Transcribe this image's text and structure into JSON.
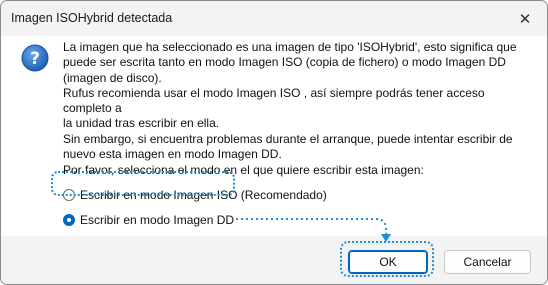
{
  "window": {
    "title": "Imagen ISOHybrid detectada",
    "close_icon": "close-icon"
  },
  "message": {
    "icon": "question-icon",
    "paragraph1": "La imagen que ha seleccionado es una imagen de tipo 'ISOHybrid', esto significa que\npuede ser escrita tanto en modo Imagen ISO (copia de fichero) o modo Imagen DD\n(imagen de disco).",
    "paragraph2": "Rufus recomienda usar el modo Imagen ISO , así siempre podrás tener acceso completo a\nla unidad tras escribir en ella.",
    "paragraph3": "Sin embargo, si encuentra problemas durante el arranque, puede intentar escribir de\nnuevo esta imagen en modo Imagen DD.",
    "prompt": "Por favor, selecciona el modo en el que quiere escribir esta imagen:"
  },
  "options": {
    "iso_label": "Escribir en modo Imagen ISO (Recomendado)",
    "dd_label": "Escribir en modo Imagen DD",
    "selected": "dd"
  },
  "buttons": {
    "ok_label": "OK",
    "cancel_label": "Cancelar"
  },
  "colors": {
    "accent": "#0067c0",
    "highlight": "#1e8fd8"
  }
}
